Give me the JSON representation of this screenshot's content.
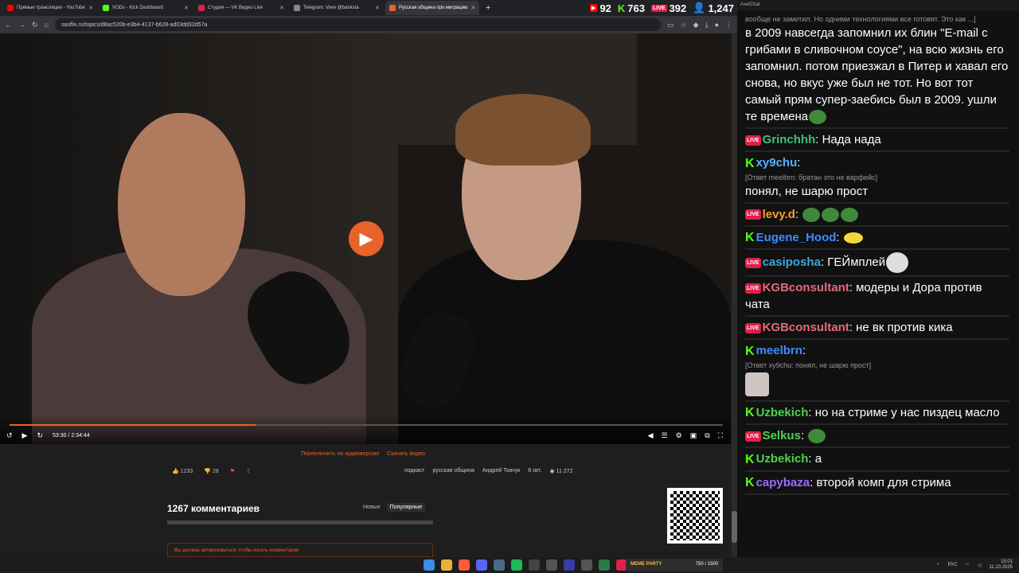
{
  "tabs": [
    {
      "label": "Прямые трансляции - YouTube",
      "color": "#ff0000"
    },
    {
      "label": "VODs - Kick Dashboard",
      "color": "#53fc18"
    },
    {
      "label": "Студия — VK Видео Live",
      "color": "#e0204a"
    },
    {
      "label": "Telegram: View @banksta",
      "color": "#888888"
    },
    {
      "label": "Русская община про миграцию",
      "color": "#e8632a"
    }
  ],
  "counters": {
    "youtube": "92",
    "kick": "763",
    "vk": "392",
    "viewers": "1,247"
  },
  "address": {
    "url": "sasflix.ru/topics/d8ac520b-e3b4-4137-b628-ad03dd32d57a"
  },
  "player": {
    "time": "53:30 / 2:34:44",
    "progress": 0.345
  },
  "below": {
    "audio_link": "Переключить на аудиоверсию",
    "download_link": "Скачать видео",
    "likes": "1233",
    "dislikes": "28",
    "tags": [
      "подкаст",
      "русская община",
      "Андрей Ткачук"
    ],
    "date": "8 окт.",
    "views": "11 272",
    "comments_title": "1267 комментариев",
    "sort_new": "Новые",
    "sort_popular": "Популярные",
    "login_warning": "Вы должны авторизоваться, чтобы писать комментарии"
  },
  "chat": {
    "title": "AxelChat",
    "top_fragment": "вообще не заметил. Но одними технологиями все готовят. Это как ...]",
    "top_text": "в 2009 навсегда запомнил их блин \"E-mail с грибами в сливочном соусе\", на всю жизнь его запомнил. потом приезжал в Питер и хавал его снова, но вкус уже был не тот. Но вот тот самый прям супер-заебись был в 2009. ушли те времена",
    "messages": [
      {
        "platform": "vk",
        "nick": "Grinchhh",
        "color": "#3fbf7f",
        "text": "Нада нада"
      },
      {
        "platform": "kick",
        "nick": "xy9chu",
        "color": "#57b2ff",
        "reply": "[Ответ meelbrn: братан это не варфейс]",
        "text": "понял, не шарю прост"
      },
      {
        "platform": "vk",
        "nick": "levy.d",
        "color": "#f0a030",
        "text": ""
      },
      {
        "platform": "kick",
        "nick": "Eugene_Hood",
        "color": "#3d8cff",
        "text": ""
      },
      {
        "platform": "vk",
        "nick": "casiposha",
        "color": "#3aa8d8",
        "text": "ГЕЙмплей"
      },
      {
        "platform": "vk",
        "nick": "KGBconsultant",
        "color": "#e46b7d",
        "text": "модеры и Дора против чата"
      },
      {
        "platform": "vk",
        "nick": "KGBconsultant",
        "color": "#e46b7d",
        "text": "не вк против кика"
      },
      {
        "platform": "kick",
        "nick": "meelbrn",
        "color": "#3d8cff",
        "reply": "[Ответ xy9chu: понял, не шарю прост]",
        "text": ""
      },
      {
        "platform": "kick",
        "nick": "Uzbekich",
        "color": "#4fd14f",
        "text": "но на стриме у нас пиздец масло"
      },
      {
        "platform": "vk",
        "nick": "Selkus",
        "color": "#4fd14f",
        "text": ""
      },
      {
        "platform": "kick",
        "nick": "Uzbekich",
        "color": "#4fd14f",
        "text": "а"
      },
      {
        "platform": "kick",
        "nick": "capybaza",
        "color": "#9b6bff",
        "text": "второй комп для стрима"
      }
    ]
  },
  "taskbar": {
    "widget_label": "MEME PARTY",
    "widget_value": "750 / 1500",
    "lang": "РУС",
    "time": "15:01",
    "date": "11.10.2025"
  }
}
